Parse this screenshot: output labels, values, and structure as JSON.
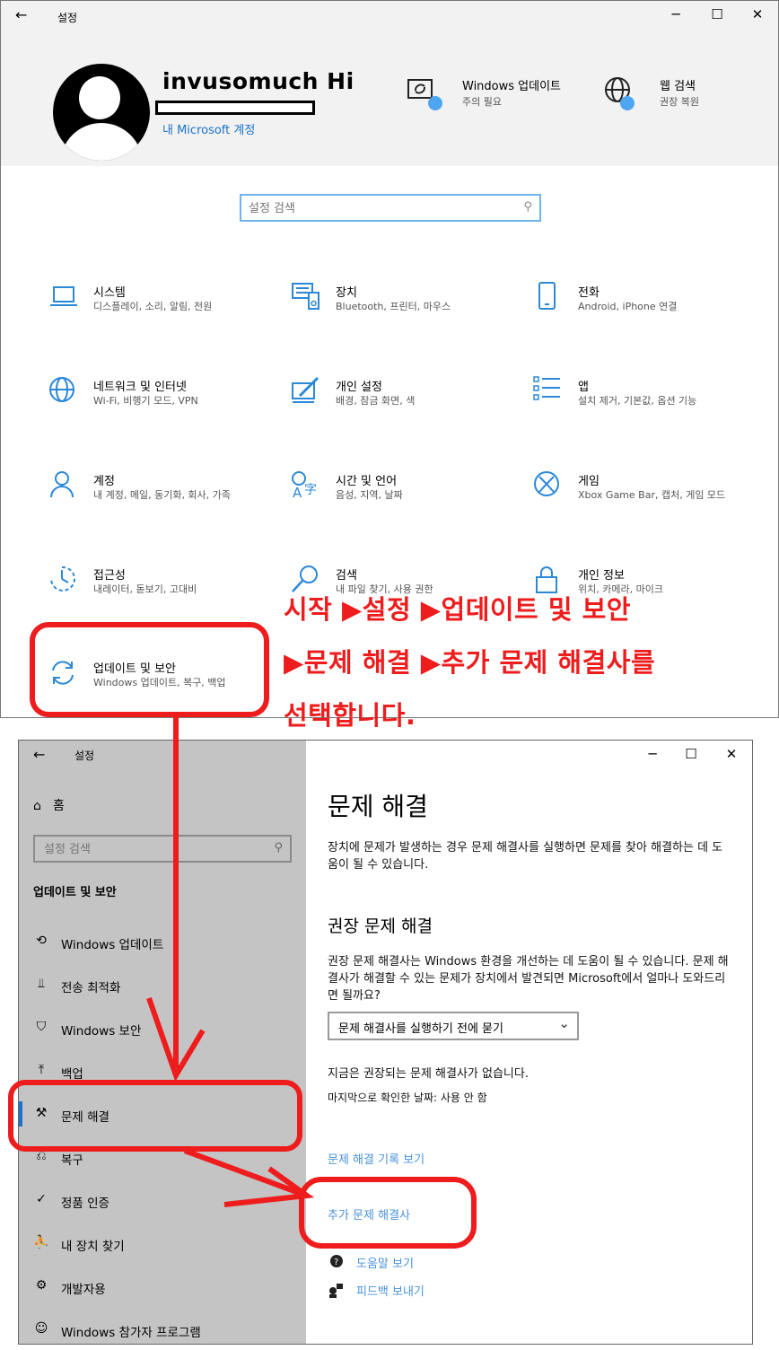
{
  "top_window": {
    "title": "설정",
    "user_name": "invusomuch Hi",
    "account_link": "내 Microsoft 계정",
    "quick_items": [
      {
        "title": "Windows 업데이트",
        "subtitle": "주의 필요",
        "icon": "windows-update-icon"
      },
      {
        "title": "웹 검색",
        "subtitle": "권장 복원",
        "icon": "globe-icon"
      }
    ],
    "search_placeholder": "설정 검색",
    "categories": [
      {
        "title": "시스템",
        "subtitle": "디스플레이, 소리, 알림, 전원",
        "icon": "laptop-icon"
      },
      {
        "title": "장치",
        "subtitle": "Bluetooth, 프린터, 마우스",
        "icon": "devices-icon"
      },
      {
        "title": "전화",
        "subtitle": "Android, iPhone 연결",
        "icon": "phone-icon"
      },
      {
        "title": "네트워크 및 인터넷",
        "subtitle": "Wi-Fi, 비행기 모드, VPN",
        "icon": "globe-icon"
      },
      {
        "title": "개인 설정",
        "subtitle": "배경, 잠금 화면, 색",
        "icon": "personalization-icon"
      },
      {
        "title": "앱",
        "subtitle": "설치 제거, 기본값, 옵션 기능",
        "icon": "apps-list-icon"
      },
      {
        "title": "계정",
        "subtitle": "내 계정, 메일, 동기화, 회사, 가족",
        "icon": "person-icon"
      },
      {
        "title": "시간 및 언어",
        "subtitle": "음성, 지역, 날짜",
        "icon": "time-language-icon"
      },
      {
        "title": "게임",
        "subtitle": "Xbox Game Bar, 캡처, 게임 모드",
        "icon": "xbox-icon"
      },
      {
        "title": "접근성",
        "subtitle": "내레이터, 돋보기, 고대비",
        "icon": "accessibility-icon"
      },
      {
        "title": "검색",
        "subtitle": "내 파일 찾기, 사용 권한",
        "icon": "search-icon"
      },
      {
        "title": "개인 정보",
        "subtitle": "위치, 카메라, 마이크",
        "icon": "lock-icon"
      },
      {
        "title": "업데이트 및 보안",
        "subtitle": "Windows 업데이트, 복구, 백업",
        "icon": "update-sync-icon"
      }
    ]
  },
  "annotation": {
    "line1": "시작 ▶설정 ▶업데이트 및 보안",
    "line2": "▶문제 해결 ▶추가 문제 해결사를",
    "line3": "선택합니다.",
    "color": "#ee1c1c"
  },
  "bottom_window": {
    "title": "설정",
    "home_label": "홈",
    "search_placeholder": "설정 검색",
    "section_header": "업데이트 및 보안",
    "nav_items": [
      {
        "label": "Windows 업데이트",
        "icon": "sync-icon"
      },
      {
        "label": "전송 최적화",
        "icon": "delivery-optimization-icon"
      },
      {
        "label": "Windows 보안",
        "icon": "shield-icon"
      },
      {
        "label": "백업",
        "icon": "backup-arrow-icon"
      },
      {
        "label": "문제 해결",
        "icon": "wrench-icon"
      },
      {
        "label": "복구",
        "icon": "recovery-icon"
      },
      {
        "label": "정품 인증",
        "icon": "check-circle-icon"
      },
      {
        "label": "내 장치 찾기",
        "icon": "find-device-icon"
      },
      {
        "label": "개발자용",
        "icon": "developer-tools-icon"
      },
      {
        "label": "Windows 참가자 프로그램",
        "icon": "insider-cat-icon"
      }
    ],
    "active_nav": "문제 해결",
    "main": {
      "heading": "문제 해결",
      "intro": "장치에 문제가 발생하는 경우 문제 해결사를 실행하면 문제를 찾아 해결하는 데 도움이 될 수 있습니다.",
      "recommended_heading": "권장 문제 해결",
      "recommended_desc": "권장 문제 해결사는 Windows 환경을 개선하는 데 도움이 될 수 있습니다. 문제 해결사가 해결할 수 있는 문제가 장치에서 발견되면 Microsoft에서 얼마나 도와드리면 될까요?",
      "dropdown_value": "문제 해결사를 실행하기 전에 묻기",
      "no_recommended": "지금은 권장되는 문제 해결사가 없습니다.",
      "last_checked": "마지막으로 확인한 날짜: 사용 안 함",
      "history_link": "문제 해결 기록 보기",
      "additional_link": "추가 문제 해결사",
      "help_link": "도움말 보기",
      "feedback_link": "피드백 보내기"
    }
  },
  "colors": {
    "accent": "#1a73c8",
    "link": "#4a93d9",
    "icon_blue": "#2b88d8",
    "sidebar_bg": "#c4c4c4",
    "annotation_red": "#ee1c1c"
  }
}
